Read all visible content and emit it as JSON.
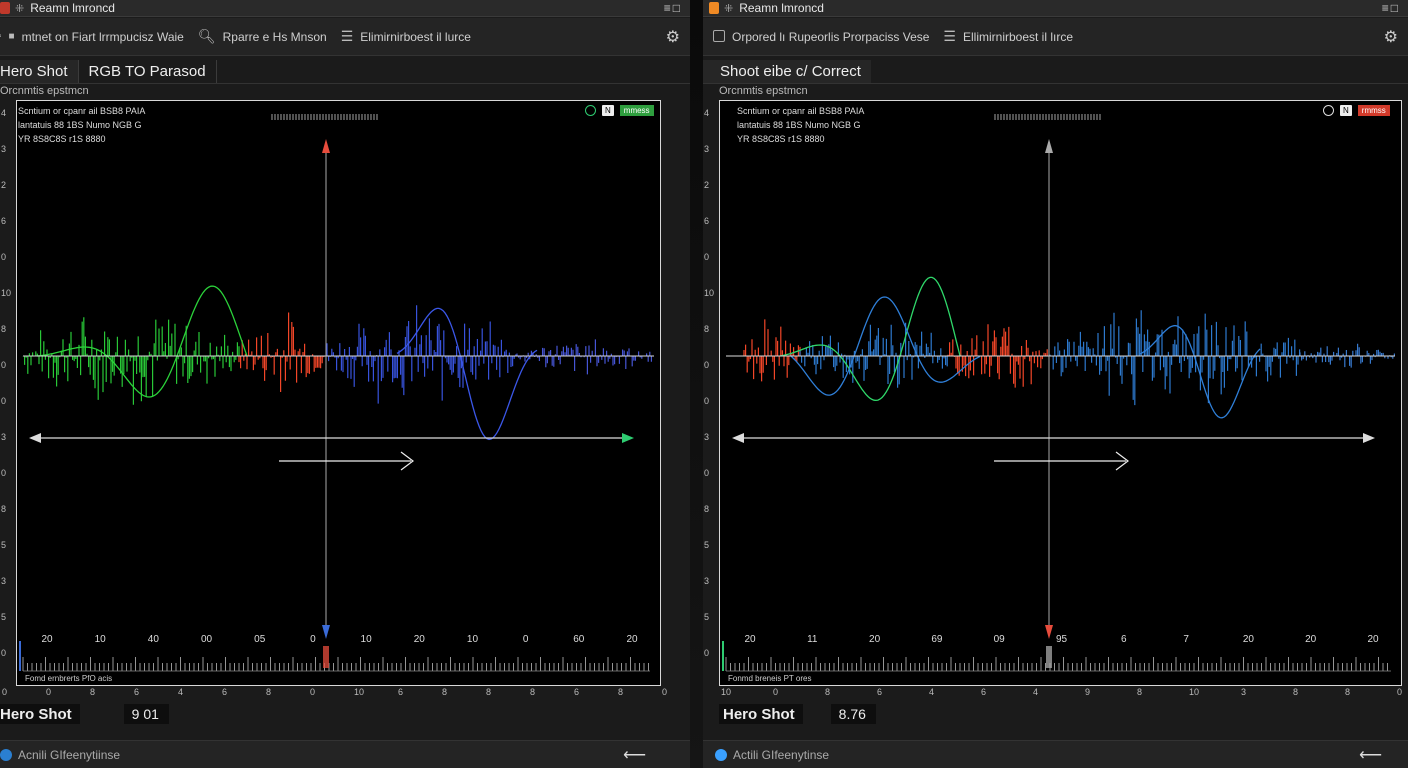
{
  "left": {
    "window_title": "Reamn lmroncd",
    "toolbar": [
      {
        "label": "mtnet on Fiart lrrmpucisz Waie"
      },
      {
        "label": "Rparre e Hs Mnson"
      },
      {
        "label": "Elimirnirboest il lurce"
      }
    ],
    "tabs": [
      {
        "label": "Hero Shot"
      },
      {
        "label": "RGB TO Parasod"
      }
    ],
    "section_label": "Orcnmtis epstmcn",
    "info_lines": [
      "Scntium or cpanr ail BSB8 PAIA",
      "lantatuis 88 1BS Numo NGB G",
      "YR 8S8C8S r1S 8880"
    ],
    "badge_tag": "mmess",
    "badge_box": "N",
    "y_ticks": [
      "4",
      "3",
      "2",
      "6",
      "0",
      "10",
      "8",
      "0",
      "0",
      "3",
      "0",
      "8",
      "5",
      "3",
      "5",
      "0"
    ],
    "x_ticks": [
      "20",
      "10",
      "40",
      "00",
      "05",
      "0",
      "10",
      "20",
      "10",
      "0",
      "60",
      "20"
    ],
    "bottom_ticks": [
      "0",
      "0",
      "8",
      "6",
      "4",
      "6",
      "8",
      "0",
      "10",
      "6",
      "8",
      "8",
      "8",
      "6",
      "8",
      "0"
    ],
    "bottom_caption": "Fomd ernbrerts PfO acis",
    "readout_label": "Hero Shot",
    "readout_value": "9 01",
    "status_text": "Acnili GIfeenytiinse",
    "accent": "#2ecc71"
  },
  "right": {
    "window_title": "Reamn lmroncd",
    "toolbar": [
      {
        "label": "Orpored lı Rupeorlis Prorpaciss Vese"
      },
      {
        "label": "Ellimirnirboest il lırce"
      }
    ],
    "tabs": [
      {
        "label": "Shoot eibe c/ Correct"
      }
    ],
    "section_label": "Orcnmtis epstmcn",
    "info_lines": [
      "Scntium or cpanr ail BSB8 PAIA",
      "lantatuis 88 1BS Numo NGB G",
      "YR 8S8C8S r1S 8880"
    ],
    "badge_tag": "rmmss",
    "badge_box": "N",
    "y_ticks": [
      "4",
      "3",
      "2",
      "6",
      "0",
      "10",
      "8",
      "0",
      "0",
      "3",
      "0",
      "8",
      "5",
      "3",
      "5",
      "0"
    ],
    "x_ticks": [
      "20",
      "11",
      "20",
      "69",
      "09",
      "95",
      "6",
      "7",
      "20",
      "20",
      "20"
    ],
    "bottom_ticks": [
      "10",
      "0",
      "8",
      "6",
      "4",
      "6",
      "4",
      "9",
      "8",
      "10",
      "3",
      "8",
      "8",
      "0"
    ],
    "bottom_caption": "Fonmd breneis PT ores",
    "readout_label": "Hero Shot",
    "readout_value": "8.76",
    "status_text": "Actili GIfeenytinse",
    "accent": "#e74c3c"
  }
}
